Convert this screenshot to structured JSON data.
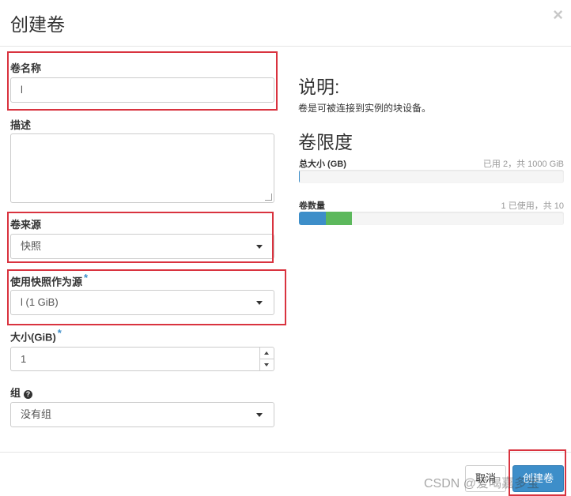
{
  "dialog": {
    "title": "创建卷",
    "close": "×"
  },
  "form": {
    "name_label": "卷名称",
    "name_value": "l",
    "description_label": "描述",
    "description_value": "",
    "source_label": "卷来源",
    "source_value": "快照",
    "snapshot_label": "使用快照作为源",
    "snapshot_required": "*",
    "snapshot_value": "l (1 GiB)",
    "size_label": "大小(GiB)",
    "size_required": "*",
    "size_value": "1",
    "group_label": "组",
    "group_help_icon": "?",
    "group_value": "没有组"
  },
  "info": {
    "heading": "说明:",
    "text": "卷是可被连接到实例的块设备。",
    "limits_heading": "卷限度",
    "total_size_label": "总大小 (GB)",
    "total_size_info": "已用 2，共 1000 GiB",
    "volume_count_label": "卷数量",
    "volume_count_info": "1 已使用，共 10"
  },
  "quota": {
    "total_size": {
      "used": 2,
      "max": 1000
    },
    "volume_count": {
      "used": 1,
      "added": 1,
      "max": 10
    },
    "colors": {
      "used": "#3d8ec9",
      "added": "#5cb85c",
      "track": "#f5f5f5"
    }
  },
  "footer": {
    "cancel_label": "取消",
    "submit_label": "创建卷"
  },
  "watermark": "CSDN @爱喝嘉多宝"
}
